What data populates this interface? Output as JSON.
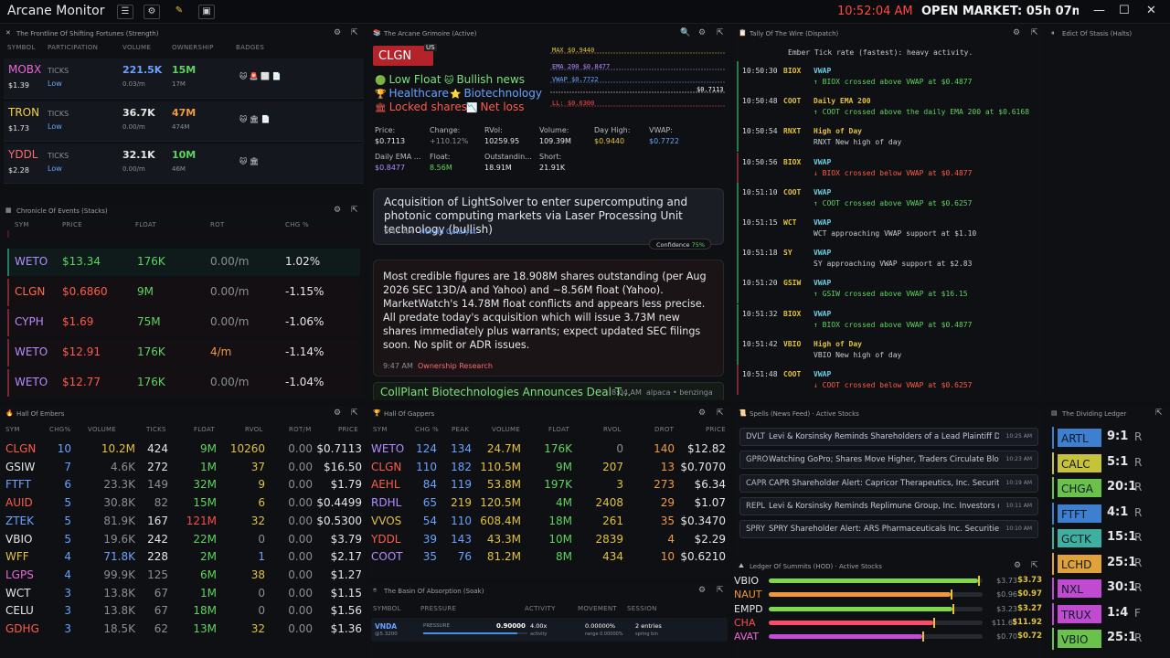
{
  "app": {
    "title": "Arcane Monitor",
    "clock": "10:52:04 AM",
    "market": "OPEN MARKET: 05h 07m 56s",
    "win_min": "—",
    "win_max": "☐",
    "win_close": "✕"
  },
  "frontline": {
    "title": "The Frontline Of Shifting Fortunes (Strength)",
    "headers": [
      "SYMBOL",
      "PARTICIPATION",
      "VOLUME",
      "OWNERSHIP",
      "BADGES"
    ],
    "rows": [
      {
        "sym": "MOBX",
        "price": "$1.39",
        "part": "TICKS",
        "level": "Low",
        "vol": "221.5K",
        "volsub": "0.03/m",
        "own": "15M",
        "ownsub": "17M",
        "badges": "🐱 🚨 ⬜ 📄",
        "symcolor": "#e96ad6"
      },
      {
        "sym": "TRON",
        "price": "$1.73",
        "part": "TICKS",
        "level": "Low",
        "vol": "36.7K",
        "volsub": "0.00/m",
        "own": "47M",
        "ownsub": "474M",
        "badges": "🐱 🏛 📄",
        "symcolor": "#f3d24a"
      },
      {
        "sym": "YDDL",
        "price": "$2.28",
        "part": "TICKS",
        "level": "Low",
        "vol": "32.1K",
        "volsub": "0.00/m",
        "own": "10M",
        "ownsub": "46M",
        "badges": "🐱 🏛",
        "symcolor": "#ff6a6a"
      }
    ]
  },
  "chronicle": {
    "title": "Chronicle Of Events (Stacks)",
    "headers": [
      "SYM",
      "PRICE",
      "FLOAT",
      "ROT",
      "CHG %"
    ],
    "rows": [
      {
        "sym": "WETO",
        "price": "$13.34",
        "float": "176K",
        "rot": "0.00/m",
        "chg": "1.02%",
        "color": "#b48cff",
        "up": true
      },
      {
        "sym": "CLGN",
        "price": "$0.6860",
        "float": "9M",
        "rot": "0.00/m",
        "chg": "-1.15%",
        "color": "#ff6a4a",
        "up": false
      },
      {
        "sym": "CYPH",
        "price": "$1.69",
        "float": "75M",
        "rot": "0.00/m",
        "chg": "-1.06%",
        "color": "#b48cff",
        "up": false
      },
      {
        "sym": "WETO",
        "price": "$12.91",
        "float": "176K",
        "rot": "4/m",
        "chg": "-1.14%",
        "color": "#b48cff",
        "up": false
      },
      {
        "sym": "WETO",
        "price": "$12.77",
        "float": "176K",
        "rot": "0.00/m",
        "chg": "-1.04%",
        "color": "#b48cff",
        "up": false
      }
    ]
  },
  "grimoire": {
    "title": "The Arcane Grimoire (Active)",
    "sym": "CLGN",
    "flag": "US",
    "tags": [
      {
        "icon": "🟢",
        "text": "Low Float",
        "color": "#7ee07e"
      },
      {
        "icon": "🐱",
        "text": "Bullish news",
        "color": "#7ee07e"
      },
      {
        "icon": "🏆",
        "text": "Healthcare",
        "color": "#6aa2ff"
      },
      {
        "icon": "⭐",
        "text": "Biotechnology",
        "color": "#6aa2ff"
      },
      {
        "icon": "🏛",
        "text": "Locked shares",
        "color": "#ff5a4a"
      },
      {
        "icon": "📉",
        "text": "Net loss",
        "color": "#ff5a4a"
      }
    ],
    "stats": [
      {
        "label": "Price:",
        "value": "$0.7113",
        "color": "#e6e6e6"
      },
      {
        "label": "Change:",
        "value": "+110.12%",
        "color": "#8a8f96"
      },
      {
        "label": "RVol:",
        "value": "10259.95",
        "color": "#e6e6e6"
      },
      {
        "label": "Volume:",
        "value": "109.39M",
        "color": "#e6e6e6"
      },
      {
        "label": "Day High:",
        "value": "$0.9440",
        "color": "#e2c23a"
      },
      {
        "label": "VWAP:",
        "value": "$0.7722",
        "color": "#6aa2ff"
      },
      {
        "label": "Daily EMA ...",
        "value": "$0.8477",
        "color": "#b48cff"
      },
      {
        "label": "Float:",
        "value": "8.56M",
        "color": "#5fd35f"
      },
      {
        "label": "Outstandin...",
        "value": "18.91M",
        "color": "#e6e6e6"
      },
      {
        "label": "Short:",
        "value": "21.91K",
        "color": "#e6e6e6"
      }
    ],
    "chart_labels": [
      {
        "text": "MAX $0.9440",
        "color": "#e2c23a"
      },
      {
        "text": "EMA 200 $0.8477",
        "color": "#b48cff"
      },
      {
        "text": "VWAP $0.7722",
        "color": "#6aa2ff"
      },
      {
        "text": "$0.7113",
        "color": "#ffffff"
      },
      {
        "text": "LL: $0.6300",
        "color": "#ff4b4b"
      }
    ],
    "news1": {
      "text": "Acquisition of LightSolver to enter supercomputing and photonic computing markets via Laser Processing Unit technology (bullish)",
      "time": "9:47 AM",
      "source": "Herald Catalyst",
      "confidence": "Confidence",
      "conf_val": "75%"
    },
    "news2": {
      "text": "Most credible figures are 18.908M shares outstanding (per Aug 2026 SEC 13D/A and Yahoo) and ~8.56M float (Yahoo). MarketWatch's 14.78M float conflicts and appears less precise. All predate today's acquisition which will issue 3.73M new shares immediately plus warrants; expect updated SEC filings soon. No split or ADR issues.",
      "time": "9:47 AM",
      "source": "Ownership Research"
    },
    "news3": {
      "text": "CollPlant Biotechnologies Announces Deal T...",
      "time": "8:04 AM",
      "source": "alpaca • benzinga"
    }
  },
  "wire": {
    "title": "Tally Of The Wire (Dispatch)",
    "top": "Ember Tick rate (fastest): heavy activity.",
    "rows": [
      {
        "time": "10:50:30",
        "sym": "BIOX",
        "type": "VWAP",
        "msg": "↑ BIOX crossed above VWAP at $0.4877",
        "up": true
      },
      {
        "time": "10:50:48",
        "sym": "COOT",
        "type": "Daily EMA 200",
        "msg": "↑ COOT crossed above the daily EMA 200 at $0.6168",
        "up": true
      },
      {
        "time": "10:50:54",
        "sym": "RNXT",
        "type": "High of Day",
        "msg": "RNXT New high of day",
        "up": null
      },
      {
        "time": "10:50:56",
        "sym": "BIOX",
        "type": "VWAP",
        "msg": "↓ BIOX crossed below VWAP at $0.4877",
        "up": false
      },
      {
        "time": "10:51:10",
        "sym": "COOT",
        "type": "VWAP",
        "msg": "↑ COOT crossed above VWAP at $0.6257",
        "up": true
      },
      {
        "time": "10:51:15",
        "sym": "WCT",
        "type": "VWAP",
        "msg": "WCT approaching VWAP support at $1.10",
        "up": null
      },
      {
        "time": "10:51:18",
        "sym": "SY",
        "type": "VWAP",
        "msg": "SY approaching VWAP support at $2.83",
        "up": null
      },
      {
        "time": "10:51:20",
        "sym": "GSIW",
        "type": "VWAP",
        "msg": "↑ GSIW crossed above VWAP at $16.15",
        "up": true
      },
      {
        "time": "10:51:32",
        "sym": "BIOX",
        "type": "VWAP",
        "msg": "↑ BIOX crossed above VWAP at $0.4877",
        "up": true
      },
      {
        "time": "10:51:42",
        "sym": "VBIO",
        "type": "High of Day",
        "msg": "VBIO New high of day",
        "up": null
      },
      {
        "time": "10:51:48",
        "sym": "COOT",
        "type": "VWAP",
        "msg": "↓ COOT crossed below VWAP at $0.6257",
        "up": false
      }
    ]
  },
  "edict": {
    "title": "Edict Of Stasis (Halts)"
  },
  "embers": {
    "title": "Hall Of Embers",
    "headers": [
      "SYM",
      "CHG%",
      "VOLUME",
      "TICKS",
      "FLOAT",
      "RVOL",
      "ROT/M",
      "PRICE"
    ],
    "rows": [
      {
        "sym": "CLGN",
        "chg": "10",
        "vol": "10.2M",
        "ticks": "424",
        "float": "9M",
        "rvol": "10260",
        "rot": "0.00",
        "price": "$0.7113",
        "c": "#ff5a4a"
      },
      {
        "sym": "GSIW",
        "chg": "7",
        "vol": "4.6K",
        "ticks": "272",
        "float": "1M",
        "rvol": "37",
        "rot": "0.00",
        "price": "$16.50",
        "c": "#e6e6e6"
      },
      {
        "sym": "FTFT",
        "chg": "6",
        "vol": "23.3K",
        "ticks": "149",
        "float": "32M",
        "rvol": "9",
        "rot": "0.00",
        "price": "$1.79",
        "c": "#6aa2ff"
      },
      {
        "sym": "AUID",
        "chg": "5",
        "vol": "30.8K",
        "ticks": "82",
        "float": "15M",
        "rvol": "6",
        "rot": "0.00",
        "price": "$0.4499",
        "c": "#ff5a4a"
      },
      {
        "sym": "ZTEK",
        "chg": "5",
        "vol": "81.9K",
        "ticks": "167",
        "float": "121M",
        "rvol": "32",
        "rot": "0.00",
        "price": "$0.5300",
        "c": "#6aa2ff"
      },
      {
        "sym": "VBIO",
        "chg": "5",
        "vol": "19.6K",
        "ticks": "242",
        "float": "22M",
        "rvol": "0",
        "rot": "0.00",
        "price": "$3.79",
        "c": "#e6e6e6"
      },
      {
        "sym": "WFF",
        "chg": "4",
        "vol": "71.8K",
        "ticks": "228",
        "float": "2M",
        "rvol": "1",
        "rot": "0.00",
        "price": "$2.17",
        "c": "#e2c23a"
      },
      {
        "sym": "LGPS",
        "chg": "4",
        "vol": "99.9K",
        "ticks": "125",
        "float": "6M",
        "rvol": "38",
        "rot": "0.00",
        "price": "$1.27",
        "c": "#e96ad6"
      },
      {
        "sym": "WCT",
        "chg": "3",
        "vol": "13.8K",
        "ticks": "67",
        "float": "1M",
        "rvol": "0",
        "rot": "0.00",
        "price": "$1.15",
        "c": "#e6e6e6"
      },
      {
        "sym": "CELU",
        "chg": "3",
        "vol": "13.8K",
        "ticks": "67",
        "float": "18M",
        "rvol": "0",
        "rot": "0.00",
        "price": "$1.56",
        "c": "#e6e6e6"
      },
      {
        "sym": "GDHG",
        "chg": "3",
        "vol": "18.5K",
        "ticks": "62",
        "float": "13M",
        "rvol": "32",
        "rot": "0.00",
        "price": "$1.36",
        "c": "#ff5a4a"
      }
    ]
  },
  "gappers": {
    "title": "Hall Of Gappers",
    "headers": [
      "SYM",
      "CHG %",
      "PEAK",
      "VOLUME",
      "FLOAT",
      "RVOL",
      "DROT",
      "PRICE"
    ],
    "rows": [
      {
        "sym": "WETO",
        "chg": "124",
        "peak": "134",
        "vol": "24.7M",
        "float": "176K",
        "rvol": "0",
        "drot": "140",
        "price": "$12.82",
        "c": "#b48cff"
      },
      {
        "sym": "CLGN",
        "chg": "110",
        "peak": "182",
        "vol": "110.5M",
        "float": "9M",
        "rvol": "207",
        "drot": "13",
        "price": "$0.7070",
        "c": "#ff5a4a"
      },
      {
        "sym": "AEHL",
        "chg": "84",
        "peak": "119",
        "vol": "53.8M",
        "float": "197K",
        "rvol": "3",
        "drot": "273",
        "price": "$6.34",
        "c": "#ff5a4a"
      },
      {
        "sym": "RDHL",
        "chg": "65",
        "peak": "219",
        "vol": "120.5M",
        "float": "4M",
        "rvol": "2408",
        "drot": "29",
        "price": "$1.07",
        "c": "#b48cff"
      },
      {
        "sym": "VVOS",
        "chg": "54",
        "peak": "110",
        "vol": "608.4M",
        "float": "18M",
        "rvol": "261",
        "drot": "35",
        "price": "$0.3470",
        "c": "#e2c23a"
      },
      {
        "sym": "YDDL",
        "chg": "39",
        "peak": "143",
        "vol": "43.3M",
        "float": "10M",
        "rvol": "2839",
        "drot": "4",
        "price": "$2.29",
        "c": "#ff5a4a"
      },
      {
        "sym": "COOT",
        "chg": "35",
        "peak": "76",
        "vol": "81.2M",
        "float": "8M",
        "rvol": "434",
        "drot": "10",
        "price": "$0.6210",
        "c": "#b48cff"
      }
    ]
  },
  "basin": {
    "title": "The Basin Of Absorption (Soak)",
    "headers": [
      "SYMBOL",
      "PRESSURE",
      "ACTIVITY",
      "MOVEMENT",
      "SESSION"
    ],
    "row": {
      "sym": "VNDA",
      "sub": "@5.3200",
      "plabel": "PRESSURE",
      "pval": "0.90000",
      "act": "4.00x",
      "actsub": "activity",
      "mov": "0.00000%",
      "movsub": "range 0.00000%",
      "sess": "2 entries",
      "sesssub": "spring bin"
    }
  },
  "spells": {
    "title": "Spells (News Feed) · Active Stocks",
    "rows": [
      {
        "sym": "DVLT",
        "text": "Levi & Korsinsky Reminds Shareholders of a Lead Plaintiff De...",
        "time": "10:25 AM"
      },
      {
        "sym": "GPRO",
        "text": "Watching GoPro; Shares Move Higher, Traders Circulate Bloo...",
        "time": "10:23 AM"
      },
      {
        "sym": "CAPR",
        "text": "CAPR Shareholder Alert: Capricor Therapeutics, Inc. Securitie...",
        "time": "10:19 AM"
      },
      {
        "sym": "REPL",
        "text": "Levi & Korsinsky Reminds Replimune Group, Inc. Investors of t...",
        "time": "10:11 AM"
      },
      {
        "sym": "SPRY",
        "text": "SPRY Shareholder Alert: ARS Pharmaceuticals Inc. Securities ...",
        "time": "10:10 AM"
      }
    ]
  },
  "summits": {
    "title": "Ledger Of Summits (HOD) · Active Stocks",
    "rows": [
      {
        "sym": "VBIO",
        "level": 0.98,
        "low": "$3.73",
        "high": "$3.73",
        "c": "#7ed84a",
        "sc": "#e6e6e6"
      },
      {
        "sym": "NAUT",
        "level": 0.85,
        "low": "$0.96",
        "high": "$0.97",
        "c": "#f2963b",
        "sc": "#f2963b"
      },
      {
        "sym": "EMPD",
        "level": 0.86,
        "low": "$3.23",
        "high": "$3.27",
        "c": "#7ed84a",
        "sc": "#e6e6e6"
      },
      {
        "sym": "CHA",
        "level": 0.77,
        "low": "$11.65",
        "high": "$11.92",
        "c": "#ff4b6a",
        "sc": "#ff4b4b"
      },
      {
        "sym": "AVAT",
        "level": 0.72,
        "low": "$0.70",
        "high": "$0.72",
        "c": "#c64ad8",
        "sc": "#e96ad6"
      }
    ]
  },
  "ledger": {
    "title": "The Dividing Ledger",
    "rows": [
      {
        "sym": "ARTL",
        "ratio": "9:1",
        "r": "R",
        "bg": "#3f7fd0"
      },
      {
        "sym": "CALC",
        "ratio": "5:1",
        "r": "R",
        "bg": "#c8c23a"
      },
      {
        "sym": "CHGA",
        "ratio": "20:1",
        "r": "R",
        "bg": "#6bc24a"
      },
      {
        "sym": "FTFT",
        "ratio": "4:1",
        "r": "R",
        "bg": "#3f7fd0"
      },
      {
        "sym": "GCTK",
        "ratio": "15:1",
        "r": "R",
        "bg": "#3fb0a0"
      },
      {
        "sym": "LCHD",
        "ratio": "25:1",
        "r": "R",
        "bg": "#e2a23a"
      },
      {
        "sym": "NXL",
        "ratio": "30:1",
        "r": "R",
        "bg": "#c04ad0"
      },
      {
        "sym": "TRUX",
        "ratio": "1:4",
        "r": "F",
        "bg": "#c04ad0"
      },
      {
        "sym": "VBIO",
        "ratio": "25:1",
        "r": "R",
        "bg": "#6bc24a"
      }
    ]
  }
}
